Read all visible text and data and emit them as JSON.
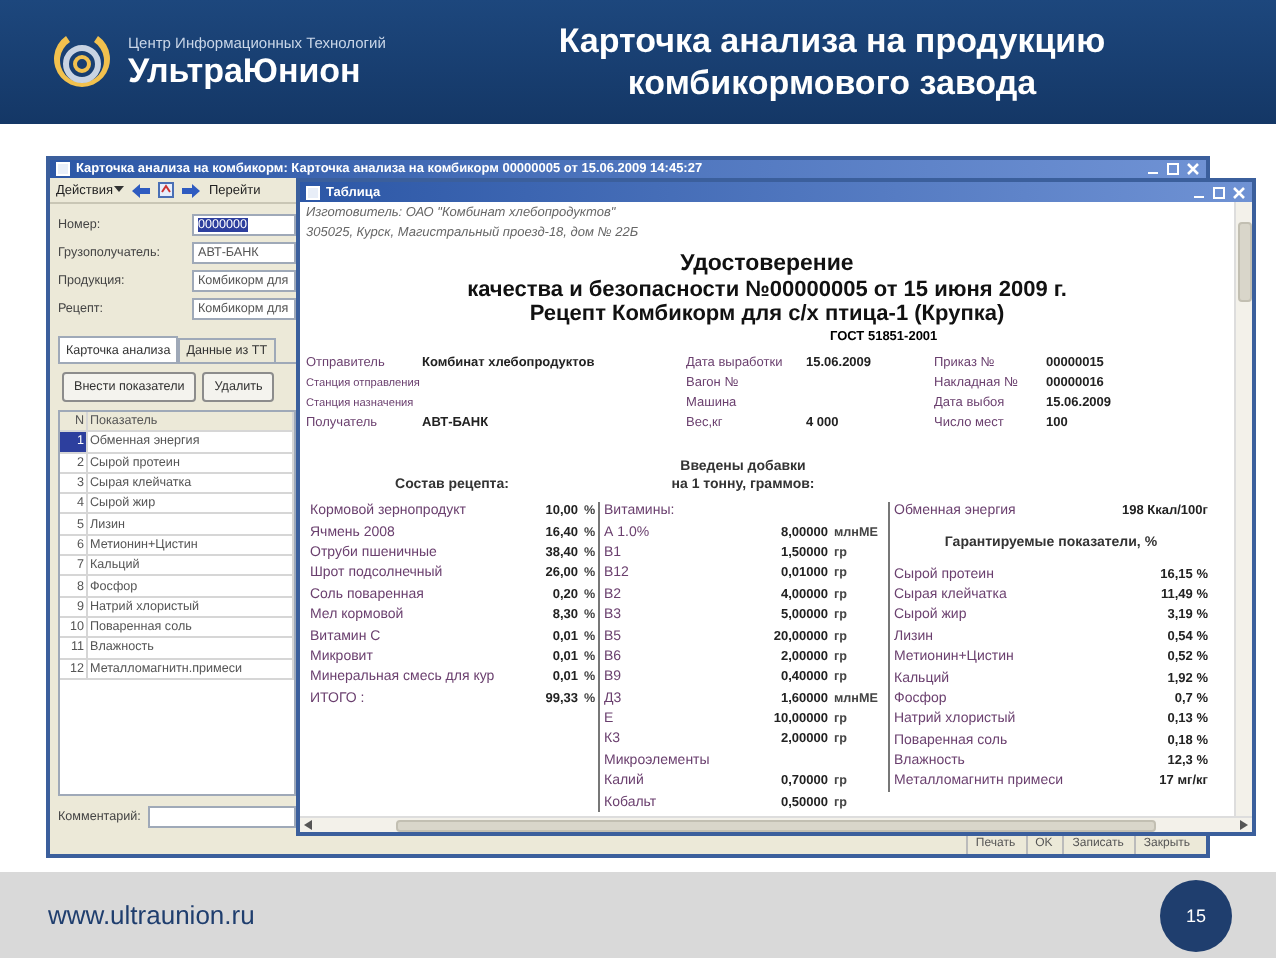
{
  "slide": {
    "logo_caption": "Центр Информационных Технологий",
    "logo_name": "УльтраЮнион",
    "title": "Карточка анализа на продукцию комбикормового завода",
    "footer_url": "www.ultraunion.ru",
    "page_number": "15"
  },
  "main_window": {
    "title": "Карточка анализа на комбикорм: Карточка анализа на комбикорм 00000005 от 15.06.2009 14:45:27",
    "actions_menu": "Действия",
    "go_label": "Перейти",
    "fields": [
      {
        "label": "Номер:",
        "value": "0000000",
        "highlighted": true
      },
      {
        "label": "Грузополучатель:",
        "value": "АВТ-БАНК",
        "highlighted": false
      },
      {
        "label": "Продукция:",
        "value": "Комбикорм для",
        "highlighted": false
      },
      {
        "label": "Рецепт:",
        "value": "Комбикорм для",
        "highlighted": false
      }
    ],
    "tabs": [
      {
        "label": "Карточка анализа",
        "selected": true
      },
      {
        "label": "Данные из ТТ",
        "selected": false
      }
    ],
    "buttons": [
      "Внести показатели",
      "Удалить"
    ],
    "grid_columns": [
      "N",
      "Показатель"
    ],
    "grid_rows": [
      {
        "n": "1",
        "name": "Обменная энергия",
        "selected": true
      },
      {
        "n": "2",
        "name": "Сырой протеин",
        "selected": false
      },
      {
        "n": "3",
        "name": "Сырая клейчатка",
        "selected": false
      },
      {
        "n": "4",
        "name": "Сырой жир",
        "selected": false
      },
      {
        "n": "5",
        "name": "Лизин",
        "selected": false
      },
      {
        "n": "6",
        "name": "Метионин+Цистин",
        "selected": false
      },
      {
        "n": "7",
        "name": "Кальций",
        "selected": false
      },
      {
        "n": "8",
        "name": "Фосфор",
        "selected": false
      },
      {
        "n": "9",
        "name": "Натрий хлористый",
        "selected": false
      },
      {
        "n": "10",
        "name": "Поваренная соль",
        "selected": false
      },
      {
        "n": "11",
        "name": "Влажность",
        "selected": false
      },
      {
        "n": "12",
        "name": "Металломагнитн.примеси",
        "selected": false
      }
    ],
    "comment_label": "Комментарий:",
    "bottom_buttons": [
      "Печать",
      "OK",
      "Записать",
      "Закрыть"
    ]
  },
  "table_window": {
    "title": "Таблица",
    "maker": "Изготовитель: ОАО \"Комбинат хлебопродуктов\"",
    "address": "305025, Курск, Магистральный проезд-18, дом № 22Б",
    "heading": [
      "Удостоверение",
      "качества и безопасности №00000005 от 15 июня 2009 г.",
      "Рецепт Комбикорм для с/х птица-1 (Крупка)"
    ],
    "standard": "ГОСТ 51851-2001",
    "info_rows": [
      [
        {
          "label": "Отправитель",
          "value": "Комбинат хлебопродуктов"
        },
        {
          "label": "Дата выработки",
          "value": "15.06.2009"
        },
        {
          "label": "Приказ №",
          "value": "00000015"
        }
      ],
      [
        {
          "label": "Станция отправления"
        },
        {
          "label": "Вагон №"
        },
        {
          "label": "Накладная №",
          "value": "00000016"
        }
      ],
      [
        {
          "label": "Станция назначения"
        },
        {
          "label": "Машина"
        },
        {
          "label": "Дата выбоя",
          "value": "15.06.2009"
        }
      ],
      [
        {
          "label": "Получатель",
          "value": "АВТ-БАНК"
        },
        {
          "label": "Вес,кг",
          "value": "4 000"
        },
        {
          "label": "Число мест",
          "value": "100"
        }
      ]
    ],
    "recipe_title": "Состав рецепта:",
    "recipe": [
      {
        "name": "Кормовой зернопродукт",
        "value": "10,00",
        "unit": "%"
      },
      {
        "name": "Ячмень 2008",
        "value": "16,40",
        "unit": "%"
      },
      {
        "name": "Отруби пшеничные",
        "value": "38,40",
        "unit": "%"
      },
      {
        "name": "Шрот подсолнечный",
        "value": "26,00",
        "unit": "%"
      },
      {
        "name": "Соль поваренная",
        "value": "0,20",
        "unit": "%"
      },
      {
        "name": "Мел кормовой",
        "value": "8,30",
        "unit": "%"
      },
      {
        "name": "Витамин С",
        "value": "0,01",
        "unit": "%"
      },
      {
        "name": "Микровит",
        "value": "0,01",
        "unit": "%"
      },
      {
        "name": "Минеральная смесь для кур",
        "value": "0,01",
        "unit": "%"
      },
      {
        "name": "ИТОГО :",
        "value": "99,33",
        "unit": "%"
      }
    ],
    "additives_title": [
      "Введены добавки",
      "на 1 тонну, граммов:"
    ],
    "additives": [
      {
        "kind": "group",
        "name": "Витамины:"
      },
      {
        "kind": "item",
        "name": "А 1.0%",
        "value": "8,00000",
        "unit": "млнМЕ"
      },
      {
        "kind": "item",
        "name": "В1",
        "value": "1,50000",
        "unit": "гр"
      },
      {
        "kind": "item",
        "name": "В12",
        "value": "0,01000",
        "unit": "гр"
      },
      {
        "kind": "item",
        "name": "В2",
        "value": "4,00000",
        "unit": "гр"
      },
      {
        "kind": "item",
        "name": "В3",
        "value": "5,00000",
        "unit": "гр"
      },
      {
        "kind": "item",
        "name": "В5",
        "value": "20,00000",
        "unit": "гр"
      },
      {
        "kind": "item",
        "name": "В6",
        "value": "2,00000",
        "unit": "гр"
      },
      {
        "kind": "item",
        "name": "В9",
        "value": "0,40000",
        "unit": "гр"
      },
      {
        "kind": "item",
        "name": "Д3",
        "value": "1,60000",
        "unit": "млнМЕ"
      },
      {
        "kind": "item",
        "name": "Е",
        "value": "10,00000",
        "unit": "гр"
      },
      {
        "kind": "item",
        "name": "К3",
        "value": "2,00000",
        "unit": "гр"
      },
      {
        "kind": "group",
        "name": "Микроэлементы"
      },
      {
        "kind": "item",
        "name": "Калий",
        "value": "0,70000",
        "unit": "гр"
      },
      {
        "kind": "item",
        "name": "Кобальт",
        "value": "0,50000",
        "unit": "гр"
      }
    ],
    "energy": {
      "label": "Обменная энергия",
      "value": "198 Ккал/100г"
    },
    "indicators_title": "Гарантируемые показатели, %",
    "indicators": [
      {
        "name": "Сырой протеин",
        "value": "16,15 %"
      },
      {
        "name": "Сырая клейчатка",
        "value": "11,49 %"
      },
      {
        "name": "Сырой жир",
        "value": "3,19 %"
      },
      {
        "name": "Лизин",
        "value": "0,54 %"
      },
      {
        "name": "Метионин+Цистин",
        "value": "0,52 %"
      },
      {
        "name": "Кальций",
        "value": "1,92 %"
      },
      {
        "name": "Фосфор",
        "value": "0,7 %"
      },
      {
        "name": "Натрий хлористый",
        "value": "0,13 %"
      },
      {
        "name": "Поваренная соль",
        "value": "0,18 %"
      },
      {
        "name": "Влажность",
        "value": "12,3 %"
      },
      {
        "name": "Металломагнитн примеси",
        "value": "17 мг/кг"
      }
    ]
  }
}
